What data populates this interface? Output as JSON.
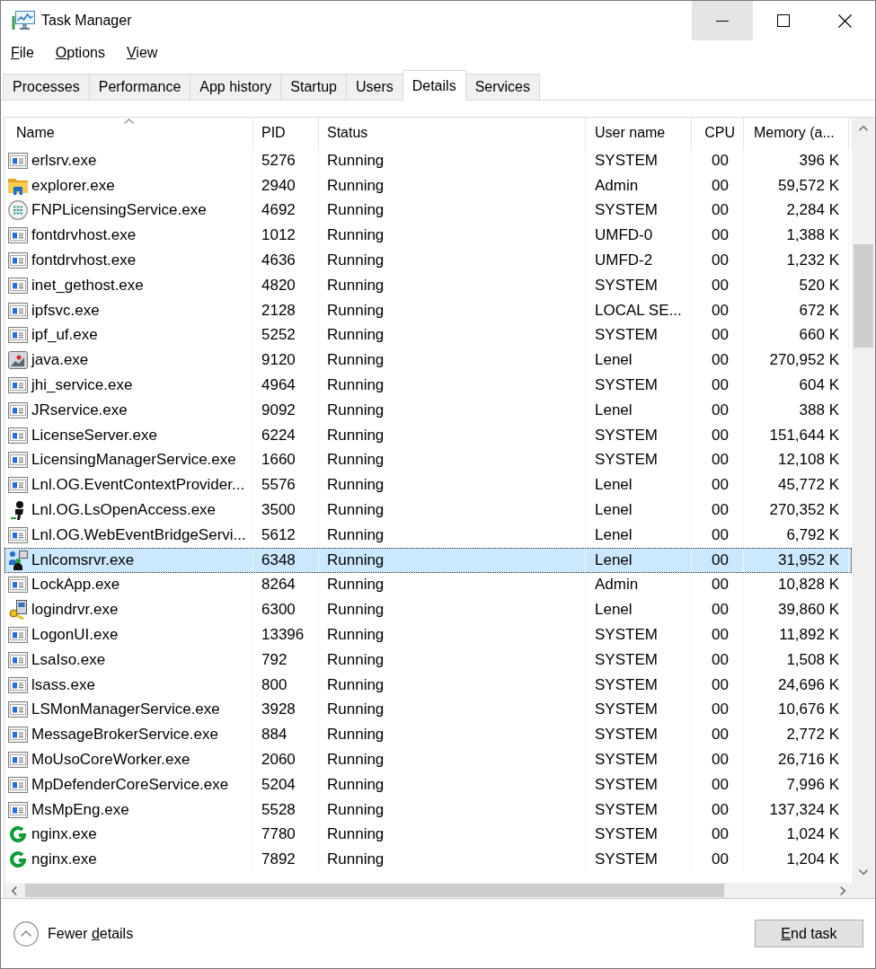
{
  "window": {
    "title": "Task Manager"
  },
  "window_buttons": [
    {
      "kind": "minimize",
      "hovered": true
    },
    {
      "kind": "maximize",
      "hovered": false
    },
    {
      "kind": "close",
      "hovered": false
    }
  ],
  "menu": [
    {
      "label_parts": [
        {
          "text": "F",
          "underline": true
        },
        {
          "text": "ile",
          "underline": false
        }
      ]
    },
    {
      "label_parts": [
        {
          "text": "O",
          "underline": true
        },
        {
          "text": "ptions",
          "underline": false
        }
      ]
    },
    {
      "label_parts": [
        {
          "text": "V",
          "underline": true
        },
        {
          "text": "iew",
          "underline": false
        }
      ]
    }
  ],
  "tabs": [
    {
      "label": "Processes",
      "selected": false
    },
    {
      "label": "Performance",
      "selected": false
    },
    {
      "label": "App history",
      "selected": false
    },
    {
      "label": "Startup",
      "selected": false
    },
    {
      "label": "Users",
      "selected": false
    },
    {
      "label": "Details",
      "selected": true
    },
    {
      "label": "Services",
      "selected": false
    }
  ],
  "table": {
    "columns": [
      {
        "label": "Name",
        "sorted": true
      },
      {
        "label": "PID",
        "sorted": false
      },
      {
        "label": "Status",
        "sorted": false
      },
      {
        "label": "User name",
        "sorted": false
      },
      {
        "label": "CPU",
        "sorted": false
      },
      {
        "label": "Memory (a...",
        "sorted": false
      }
    ],
    "rows": [
      {
        "kind": "app",
        "name": "erlsrv.exe",
        "pid": "5276",
        "status": "Running",
        "user_name": "SYSTEM",
        "cpu": "00",
        "memory": "396 K",
        "selected": false
      },
      {
        "kind": "folder",
        "name": "explorer.exe",
        "pid": "2940",
        "status": "Running",
        "user_name": "Admin",
        "cpu": "00",
        "memory": "59,572 K",
        "selected": false
      },
      {
        "kind": "disc",
        "name": "FNPLicensingService.exe",
        "pid": "4692",
        "status": "Running",
        "user_name": "SYSTEM",
        "cpu": "00",
        "memory": "2,284 K",
        "selected": false
      },
      {
        "kind": "app",
        "name": "fontdrvhost.exe",
        "pid": "1012",
        "status": "Running",
        "user_name": "UMFD-0",
        "cpu": "00",
        "memory": "1,388 K",
        "selected": false
      },
      {
        "kind": "app",
        "name": "fontdrvhost.exe",
        "pid": "4636",
        "status": "Running",
        "user_name": "UMFD-2",
        "cpu": "00",
        "memory": "1,232 K",
        "selected": false
      },
      {
        "kind": "app",
        "name": "inet_gethost.exe",
        "pid": "4820",
        "status": "Running",
        "user_name": "SYSTEM",
        "cpu": "00",
        "memory": "520 K",
        "selected": false
      },
      {
        "kind": "app",
        "name": "ipfsvc.exe",
        "pid": "2128",
        "status": "Running",
        "user_name": "LOCAL SE...",
        "cpu": "00",
        "memory": "672 K",
        "selected": false
      },
      {
        "kind": "app",
        "name": "ipf_uf.exe",
        "pid": "5252",
        "status": "Running",
        "user_name": "SYSTEM",
        "cpu": "00",
        "memory": "660 K",
        "selected": false
      },
      {
        "kind": "java",
        "name": "java.exe",
        "pid": "9120",
        "status": "Running",
        "user_name": "Lenel",
        "cpu": "00",
        "memory": "270,952 K",
        "selected": false
      },
      {
        "kind": "app",
        "name": "jhi_service.exe",
        "pid": "4964",
        "status": "Running",
        "user_name": "SYSTEM",
        "cpu": "00",
        "memory": "604 K",
        "selected": false
      },
      {
        "kind": "app",
        "name": "JRservice.exe",
        "pid": "9092",
        "status": "Running",
        "user_name": "Lenel",
        "cpu": "00",
        "memory": "388 K",
        "selected": false
      },
      {
        "kind": "app",
        "name": "LicenseServer.exe",
        "pid": "6224",
        "status": "Running",
        "user_name": "SYSTEM",
        "cpu": "00",
        "memory": "151,644 K",
        "selected": false
      },
      {
        "kind": "app",
        "name": "LicensingManagerService.exe",
        "pid": "1660",
        "status": "Running",
        "user_name": "SYSTEM",
        "cpu": "00",
        "memory": "12,108 K",
        "selected": false
      },
      {
        "kind": "app",
        "name": "Lnl.OG.EventContextProvider...",
        "pid": "5576",
        "status": "Running",
        "user_name": "Lenel",
        "cpu": "00",
        "memory": "45,772 K",
        "selected": false
      },
      {
        "kind": "figure",
        "name": "Lnl.OG.LsOpenAccess.exe",
        "pid": "3500",
        "status": "Running",
        "user_name": "Lenel",
        "cpu": "00",
        "memory": "270,352 K",
        "selected": false
      },
      {
        "kind": "app",
        "name": "Lnl.OG.WebEventBridgeServi...",
        "pid": "5612",
        "status": "Running",
        "user_name": "Lenel",
        "cpu": "00",
        "memory": "6,792 K",
        "selected": false
      },
      {
        "kind": "network",
        "name": "Lnlcomsrvr.exe",
        "pid": "6348",
        "status": "Running",
        "user_name": "Lenel",
        "cpu": "00",
        "memory": "31,952 K",
        "selected": true
      },
      {
        "kind": "app",
        "name": "LockApp.exe",
        "pid": "8264",
        "status": "Running",
        "user_name": "Admin",
        "cpu": "00",
        "memory": "10,828 K",
        "selected": false
      },
      {
        "kind": "keys",
        "name": "logindrvr.exe",
        "pid": "6300",
        "status": "Running",
        "user_name": "Lenel",
        "cpu": "00",
        "memory": "39,860 K",
        "selected": false
      },
      {
        "kind": "app",
        "name": "LogonUI.exe",
        "pid": "13396",
        "status": "Running",
        "user_name": "SYSTEM",
        "cpu": "00",
        "memory": "11,892 K",
        "selected": false
      },
      {
        "kind": "app",
        "name": "LsaIso.exe",
        "pid": "792",
        "status": "Running",
        "user_name": "SYSTEM",
        "cpu": "00",
        "memory": "1,508 K",
        "selected": false
      },
      {
        "kind": "app",
        "name": "lsass.exe",
        "pid": "800",
        "status": "Running",
        "user_name": "SYSTEM",
        "cpu": "00",
        "memory": "24,696 K",
        "selected": false
      },
      {
        "kind": "app",
        "name": "LSMonManagerService.exe",
        "pid": "3928",
        "status": "Running",
        "user_name": "SYSTEM",
        "cpu": "00",
        "memory": "10,676 K",
        "selected": false
      },
      {
        "kind": "app",
        "name": "MessageBrokerService.exe",
        "pid": "884",
        "status": "Running",
        "user_name": "SYSTEM",
        "cpu": "00",
        "memory": "2,772 K",
        "selected": false
      },
      {
        "kind": "app",
        "name": "MoUsoCoreWorker.exe",
        "pid": "2060",
        "status": "Running",
        "user_name": "SYSTEM",
        "cpu": "00",
        "memory": "26,716 K",
        "selected": false
      },
      {
        "kind": "app",
        "name": "MpDefenderCoreService.exe",
        "pid": "5204",
        "status": "Running",
        "user_name": "SYSTEM",
        "cpu": "00",
        "memory": "7,996 K",
        "selected": false
      },
      {
        "kind": "app",
        "name": "MsMpEng.exe",
        "pid": "5528",
        "status": "Running",
        "user_name": "SYSTEM",
        "cpu": "00",
        "memory": "137,324 K",
        "selected": false
      },
      {
        "kind": "g",
        "name": "nginx.exe",
        "pid": "7780",
        "status": "Running",
        "user_name": "SYSTEM",
        "cpu": "00",
        "memory": "1,024 K",
        "selected": false
      },
      {
        "kind": "g",
        "name": "nginx.exe",
        "pid": "7892",
        "status": "Running",
        "user_name": "SYSTEM",
        "cpu": "00",
        "memory": "1,204 K",
        "selected": false
      }
    ]
  },
  "footer": {
    "toggle": {
      "label_parts": [
        {
          "text": "Fewer ",
          "underline": false
        },
        {
          "text": "d",
          "underline": true
        },
        {
          "text": "etails",
          "underline": false
        }
      ]
    },
    "end_task": {
      "label_parts": [
        {
          "text": "E",
          "underline": true
        },
        {
          "text": "nd task",
          "underline": false
        }
      ]
    }
  }
}
